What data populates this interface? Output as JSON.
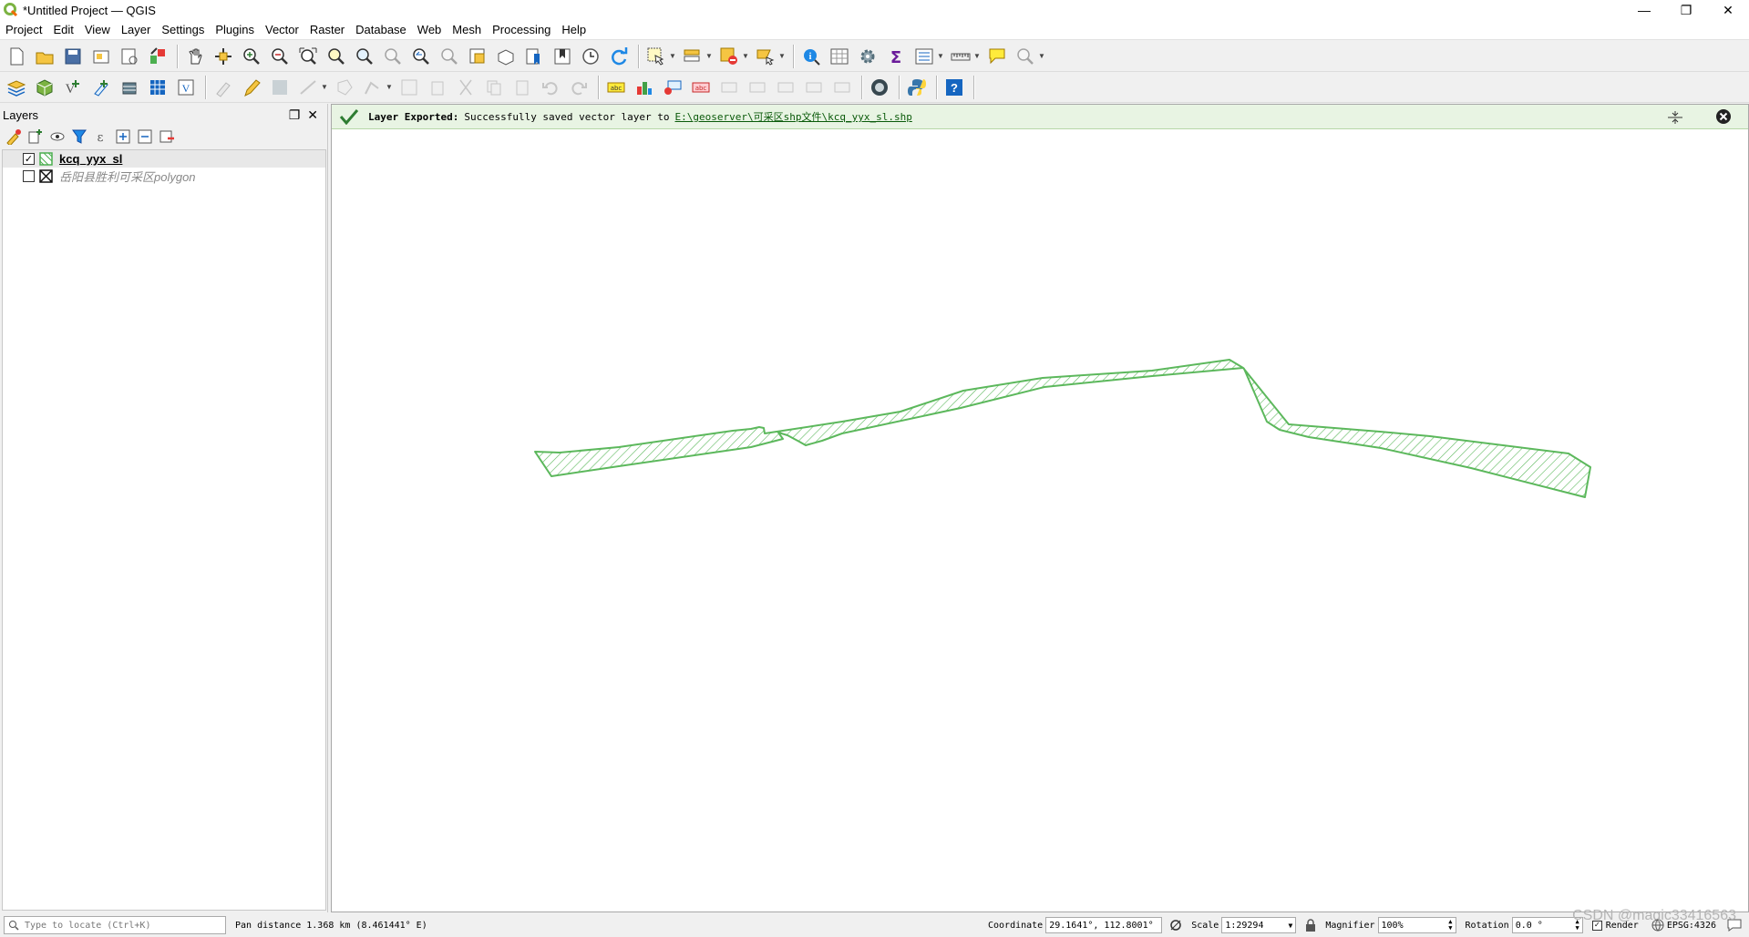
{
  "window": {
    "title": "*Untitled Project — QGIS",
    "minimize": "—",
    "restore": "❐",
    "close": "✕"
  },
  "menu": [
    "Project",
    "Edit",
    "View",
    "Layer",
    "Settings",
    "Plugins",
    "Vector",
    "Raster",
    "Database",
    "Web",
    "Mesh",
    "Processing",
    "Help"
  ],
  "layers_panel": {
    "title": "Layers",
    "layers": [
      {
        "name": "kcq_yyx_sl",
        "checked": true,
        "check_glyph": "✓",
        "style": "bold"
      },
      {
        "name": "岳阳县胜利可采区polygon",
        "checked": false,
        "check_glyph": "",
        "style": "italic"
      }
    ]
  },
  "message_bar": {
    "heading": "Layer Exported:",
    "text": "Successfully saved vector layer to",
    "link": "E:\\geoserver\\可采区shp文件\\kcq_yyx_sl.shp"
  },
  "statusbar": {
    "locator_placeholder": "Type to locate (Ctrl+K)",
    "message": "Pan distance 1.368 km (8.461441° E)",
    "coordinate_label": "Coordinate",
    "coordinate_value": "29.1641°, 112.8001°",
    "scale_label": "Scale",
    "scale_value": "1:29294",
    "magnifier_label": "Magnifier",
    "magnifier_value": "100%",
    "rotation_label": "Rotation",
    "rotation_value": "0.0 °",
    "render_label": "Render",
    "crs": "EPSG:4326"
  },
  "watermark": "CSDN @magic33416563",
  "colors": {
    "feature_stroke": "#5cb85c",
    "message_bg": "#e8f4e3"
  }
}
